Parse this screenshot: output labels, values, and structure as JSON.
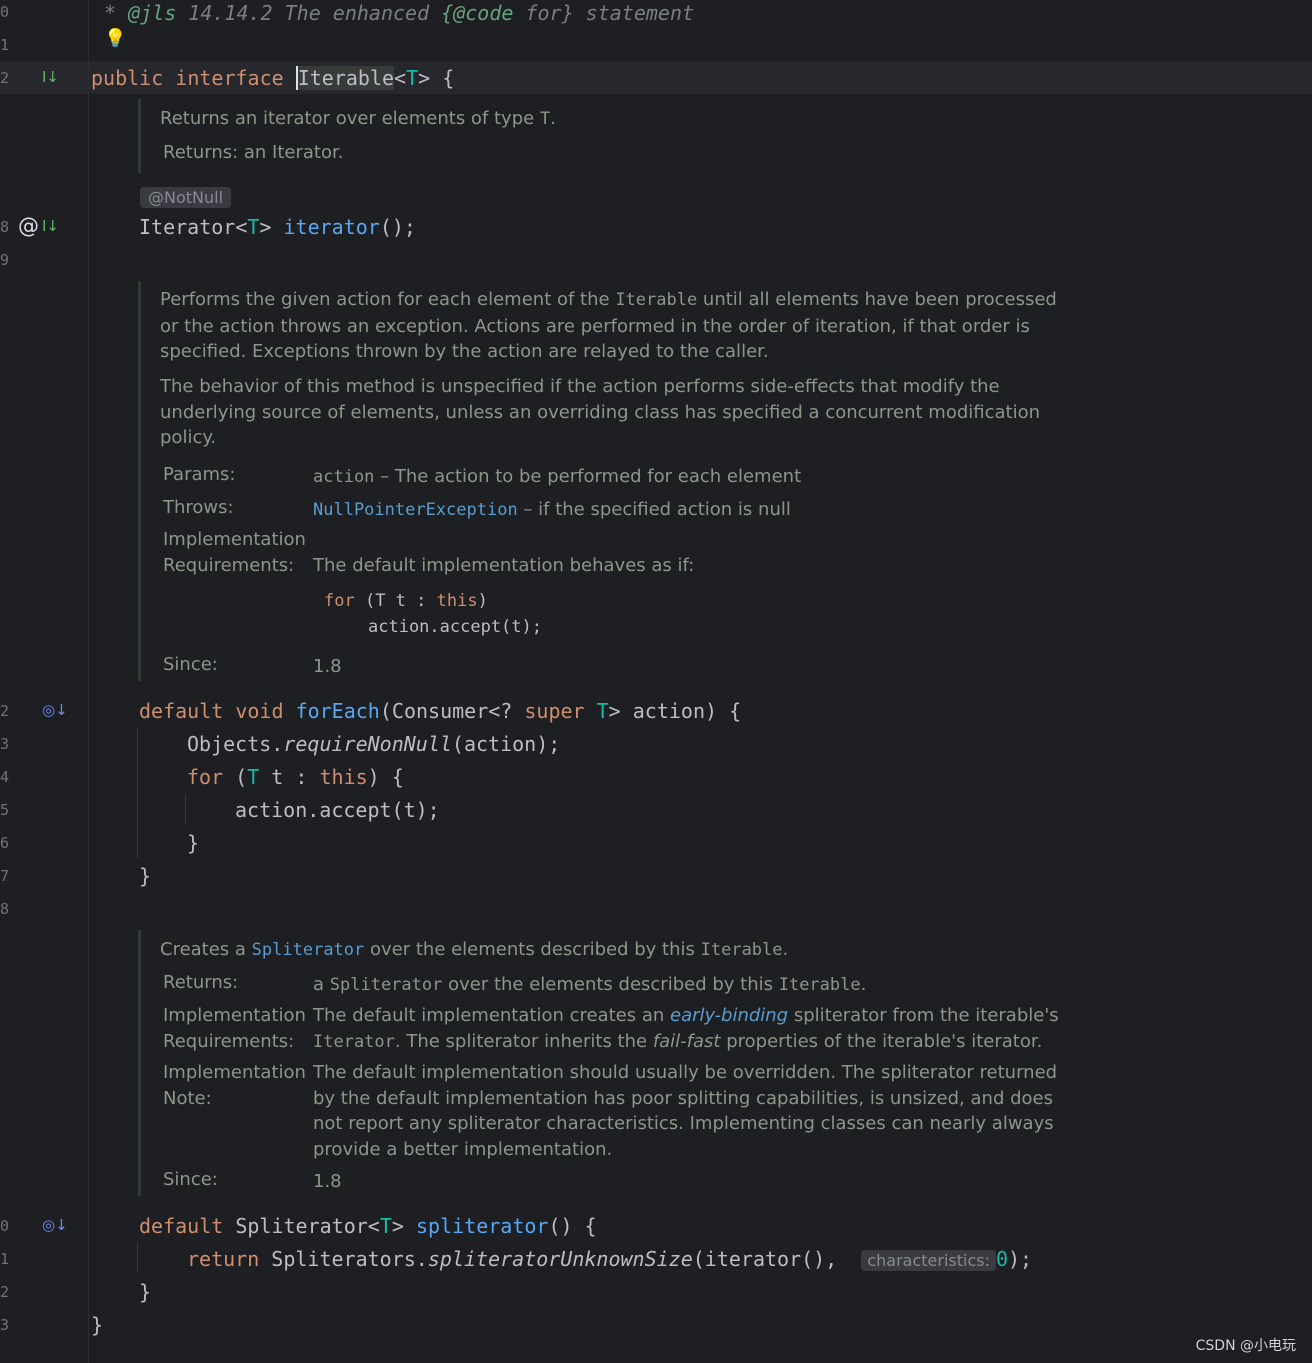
{
  "gutter": {
    "line_numbers": [
      "0",
      "1",
      "2",
      "8",
      "9",
      "2",
      "3",
      "4",
      "5",
      "6",
      "7",
      "8",
      "0",
      "1",
      "2",
      "3"
    ]
  },
  "header_comment": {
    "star": "* ",
    "tag": "@jls",
    "rest": " 14.14.2 The enhanced ",
    "code_open": "{@code",
    "code_mid": " for}",
    "end": " statement"
  },
  "interface_decl": {
    "kw1": "public",
    "kw2": "interface",
    "name": "Iterable",
    "type_param": "T",
    "open": " {"
  },
  "iterator_doc": {
    "line1": "Returns an iterator over elements of type ",
    "line1_code": "T",
    "line1_end": ".",
    "returns": "Returns: an Iterator."
  },
  "iterator_method": {
    "annotation": "@NotNull",
    "type": "Iterator",
    "type_param": "T",
    "name": "iterator",
    "tail": "();"
  },
  "foreach_doc": {
    "p1a": "Performs the given action for each element of the ",
    "p1_code": "Iterable",
    "p1b": " until all elements have been processed",
    "p1c": "or the action throws an exception. Actions are performed in the order of iteration, if that order is",
    "p1d": "specified. Exceptions thrown by the action are relayed to the caller.",
    "p2a": "The behavior of this method is unspecified if the action performs side-effects that modify the",
    "p2b": "underlying source of elements, unless an overriding class has specified a concurrent modification",
    "p2c": "policy.",
    "params_label": "Params:",
    "params_code": "action",
    "params_text": " – The action to be performed for each element",
    "throws_label": "Throws:",
    "throws_code": "NullPointerException",
    "throws_text": " – if the specified action is null",
    "impl_label1": "Implementation",
    "impl_label2": "Requirements:",
    "impl_text": "The default implementation behaves as if:",
    "code1_kw": "for",
    "code1_rest": " (T t : ",
    "code1_this": "this",
    "code1_end": ")",
    "code2": "action.accept(t);",
    "since_label": "Since:",
    "since_value": "1.8"
  },
  "foreach_method": {
    "kw1": "default",
    "kw2": "void",
    "name": "forEach",
    "p_open": "(Consumer<? ",
    "p_super": "super",
    "p_T": "T",
    "p_close": "> action) {",
    "l1a": "Objects.",
    "l1b": "requireNonNull",
    "l1c": "(action);",
    "l2_for": "for",
    "l2_open": " (",
    "l2_T": "T",
    "l2_mid": " t : ",
    "l2_this": "this",
    "l2_end": ") {",
    "l3": "action.accept(t);",
    "l4": "}",
    "l5": "}"
  },
  "spliterator_doc": {
    "l1a": "Creates a ",
    "l1_link": "Spliterator",
    "l1b": " over the elements described by this ",
    "l1_code": "Iterable",
    "l1c": ".",
    "returns_label": "Returns:",
    "returns_a": "a ",
    "returns_code": "Spliterator",
    "returns_b": " over the elements described by this ",
    "returns_code2": "Iterable",
    "returns_c": ".",
    "implreq_label1": "Implementation",
    "implreq_label2": "Requirements:",
    "implreq_a": "The default implementation creates an ",
    "implreq_link": "early-binding",
    "implreq_b": " spliterator from the iterable's",
    "implreq_code": "Iterator",
    "implreq_c": ". The spliterator inherits the ",
    "implreq_it": "fail-fast",
    "implreq_d": " properties of the iterable's iterator.",
    "implnote_label1": "Implementation",
    "implnote_label2": "Note:",
    "implnote_1": "The default implementation should usually be overridden. The spliterator returned",
    "implnote_2": "by the default implementation has poor splitting capabilities, is unsized, and does",
    "implnote_3": "not report any spliterator characteristics. Implementing classes can nearly always",
    "implnote_4": "provide a better implementation.",
    "since_label": "Since:",
    "since_value": "1.8"
  },
  "spliterator_method": {
    "kw1": "default",
    "type": " Spliterator<",
    "type_T": "T",
    "type_close": "> ",
    "name": "spliterator",
    "tail": "() {",
    "ret_kw": "return",
    "ret_a": " Spliterators.",
    "ret_fn": "spliteratorUnknownSize",
    "ret_b": "(iterator(), ",
    "hint": "characteristics:",
    "ret_num": "0",
    "ret_c": ");",
    "close": "}"
  },
  "final_brace": "}",
  "watermark": "CSDN @小电玩",
  "icons": {
    "implemented": "I↓",
    "override": "@",
    "bulb": "💡"
  }
}
